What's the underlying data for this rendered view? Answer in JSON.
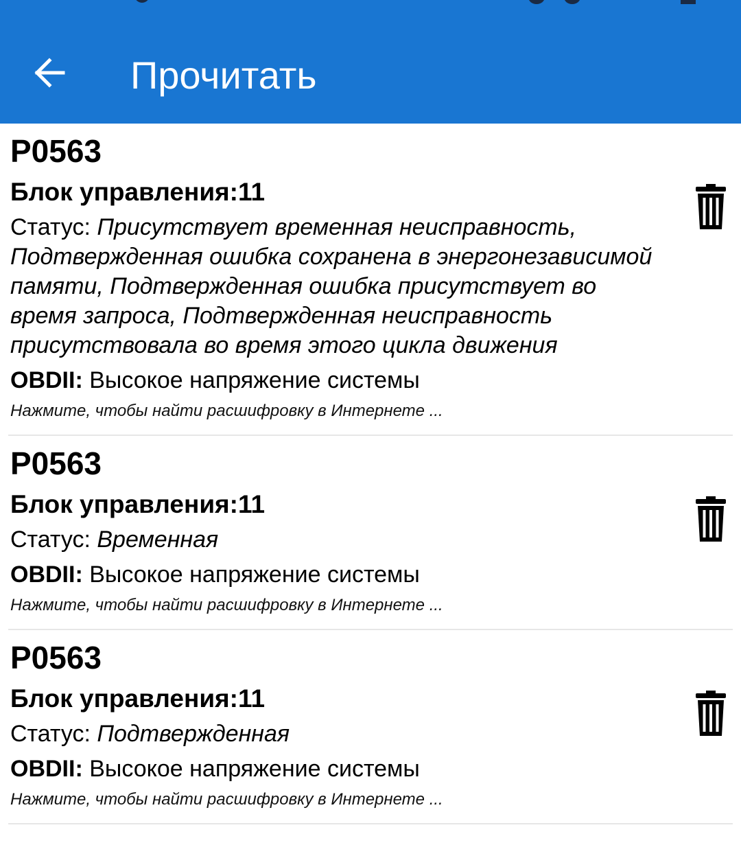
{
  "header": {
    "title": "Прочитать",
    "back_icon": "arrow-left-icon",
    "background_color": "#1976d2"
  },
  "errors": [
    {
      "code": "P0563",
      "block_label": "Блок управления:",
      "block_value": "11",
      "status_label": "Статус: ",
      "status_value": "Присутствует временная неисправность, Подтвержденная ошибка сохранена в энергонезависимой памяти, Подтвержденная ошибка присутствует во время запроса, Подтвержденная неисправность присутствовала во время этого цикла движения",
      "obd_label": "OBDII:",
      "obd_value": " Высокое напряжение системы",
      "hint": "Нажмите, чтобы найти расшифровку в Интернете ...",
      "delete_icon": "trash-icon"
    },
    {
      "code": "P0563",
      "block_label": "Блок управления:",
      "block_value": "11",
      "status_label": "Статус: ",
      "status_value": "Временная",
      "obd_label": "OBDII:",
      "obd_value": " Высокое напряжение системы",
      "hint": "Нажмите, чтобы найти расшифровку в Интернете ...",
      "delete_icon": "trash-icon"
    },
    {
      "code": "P0563",
      "block_label": "Блок управления:",
      "block_value": "11",
      "status_label": "Статус: ",
      "status_value": "Подтвержденная",
      "obd_label": "OBDII:",
      "obd_value": " Высокое напряжение системы",
      "hint": "Нажмите, чтобы найти расшифровку в Интернете ...",
      "delete_icon": "trash-icon"
    }
  ]
}
